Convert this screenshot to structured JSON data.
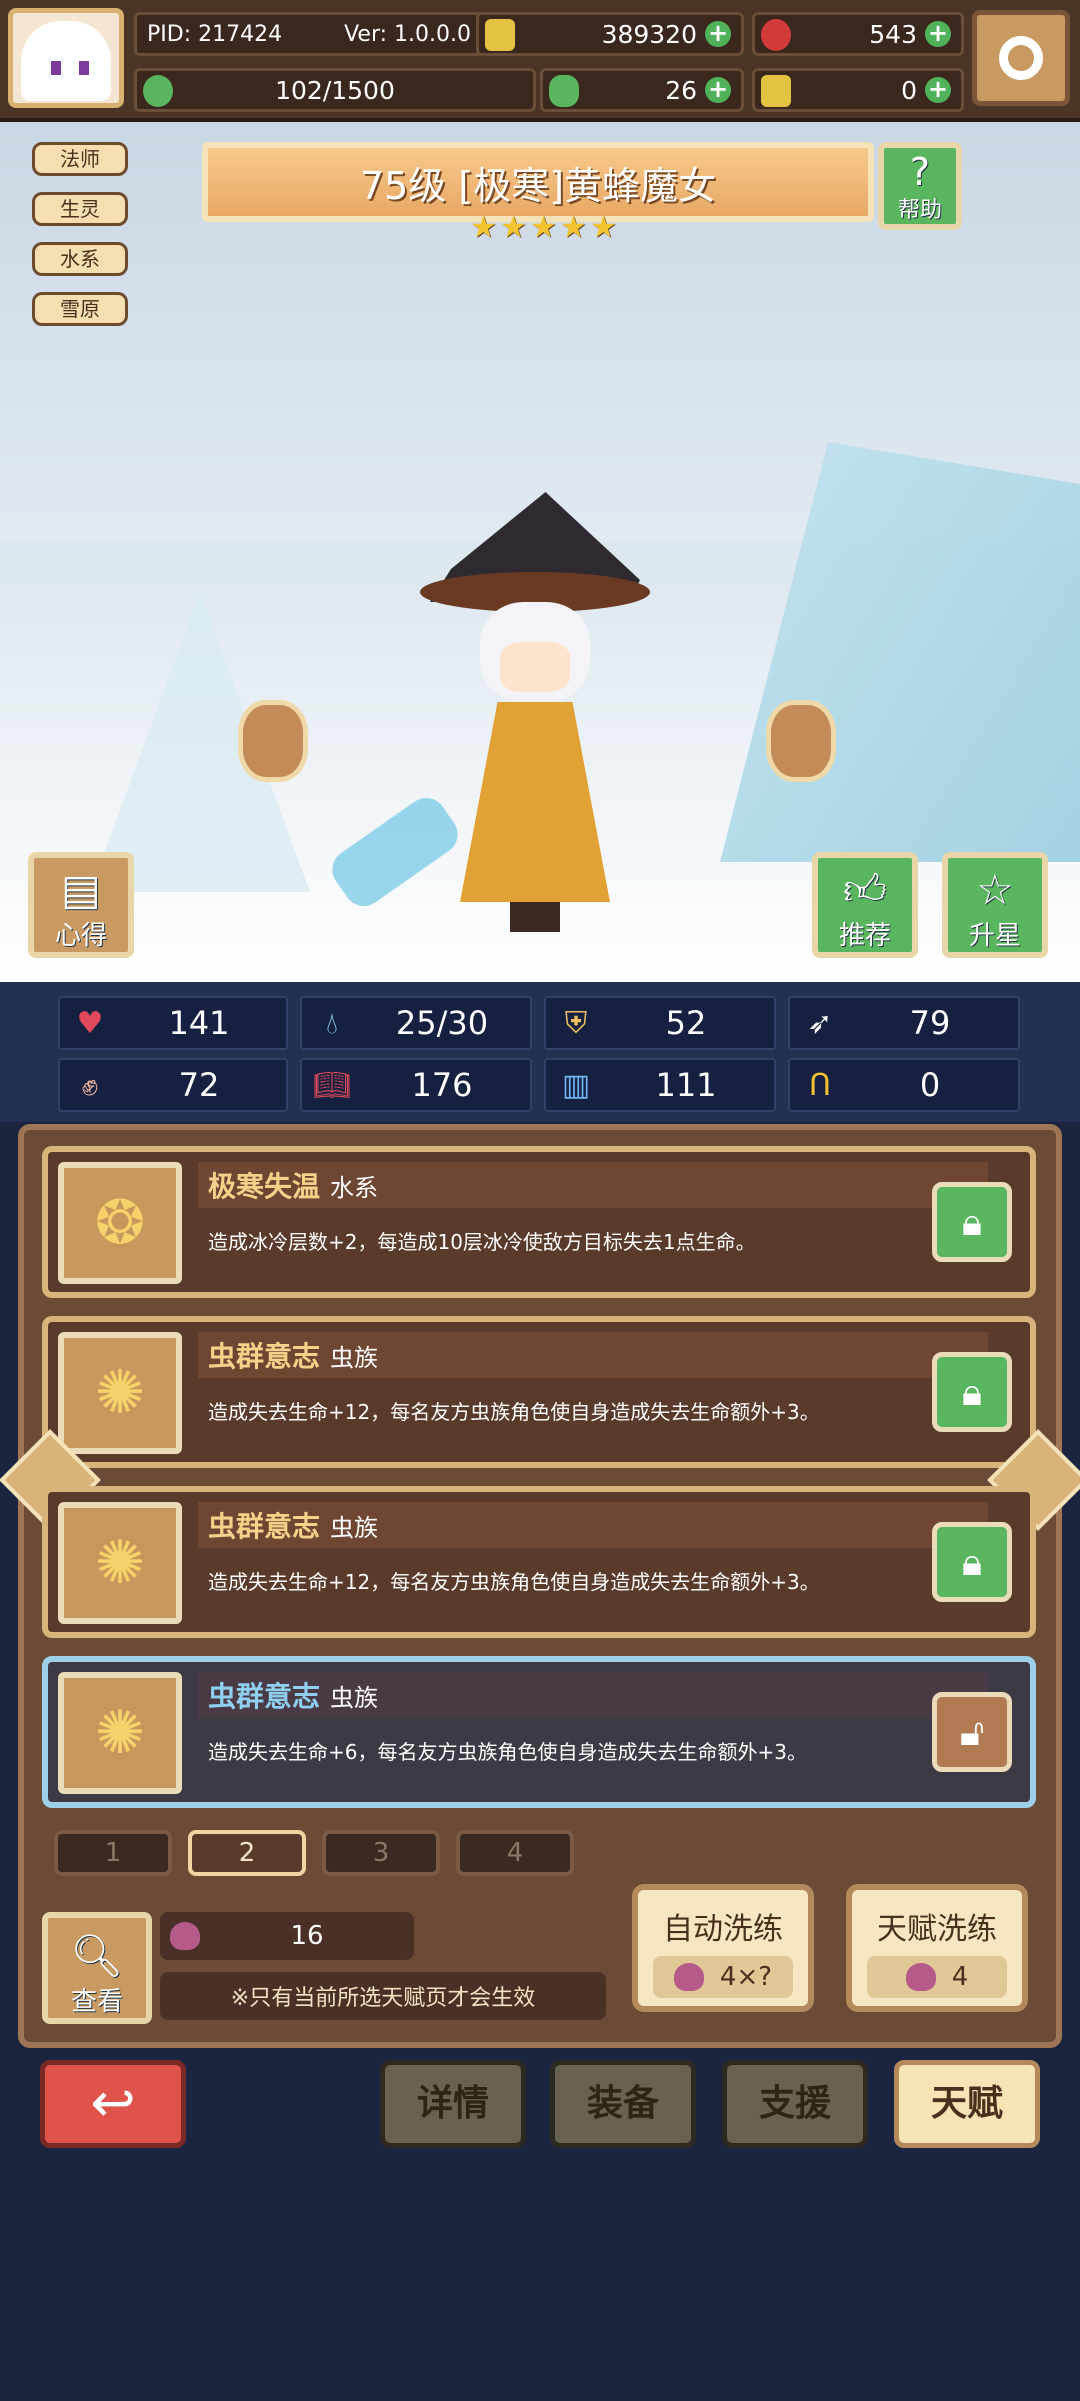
{
  "top": {
    "pid": "PID: 217424",
    "ver": "Ver: 1.0.0.0",
    "gold": "389320",
    "gems": "543",
    "stamina": "102/1500",
    "clover": "26",
    "key": "0"
  },
  "hero": {
    "title": "75级 [极寒]黄蜂魔女",
    "stars": 5,
    "tags": [
      "法师",
      "生灵",
      "水系",
      "雪原"
    ],
    "help_label": "帮助",
    "insight_label": "心得",
    "recommend_label": "推荐",
    "upstar_label": "升星"
  },
  "stats": {
    "hp": "141",
    "mana": "25/30",
    "defense": "52",
    "speed": "79",
    "attack": "72",
    "magic": "176",
    "skill": "111",
    "luck": "0"
  },
  "talents": [
    {
      "name": "极寒失温",
      "school": "水系",
      "desc": "造成冰冷层数+2，每造成10层冰冷使敌方目标失去1点生命。",
      "locked": true
    },
    {
      "name": "虫群意志",
      "school": "虫族",
      "desc": "造成失去生命+12，每名友方虫族角色使自身造成失去生命额外+3。",
      "locked": true
    },
    {
      "name": "虫群意志",
      "school": "虫族",
      "desc": "造成失去生命+12，每名友方虫族角色使自身造成失去生命额外+3。",
      "locked": true
    },
    {
      "name": "虫群意志",
      "school": "虫族",
      "desc": "造成失去生命+6，每名友方虫族角色使自身造成失去生命额外+3。",
      "locked": false
    }
  ],
  "pages": [
    "1",
    "2",
    "3",
    "4"
  ],
  "active_page": "2",
  "controls": {
    "view_label": "查看",
    "potion_count": "16",
    "note": "※只有当前所选天赋页才会生效",
    "auto_wash_label": "自动洗练",
    "auto_wash_cost": "4×?",
    "talent_wash_label": "天赋洗练",
    "talent_wash_cost": "4"
  },
  "nav": {
    "details": "详情",
    "equip": "装备",
    "support": "支援",
    "talent": "天赋"
  },
  "colors": {
    "accent_green": "#5ab65e",
    "back_red": "#e0534a",
    "frame_brown": "#6b4a36"
  }
}
